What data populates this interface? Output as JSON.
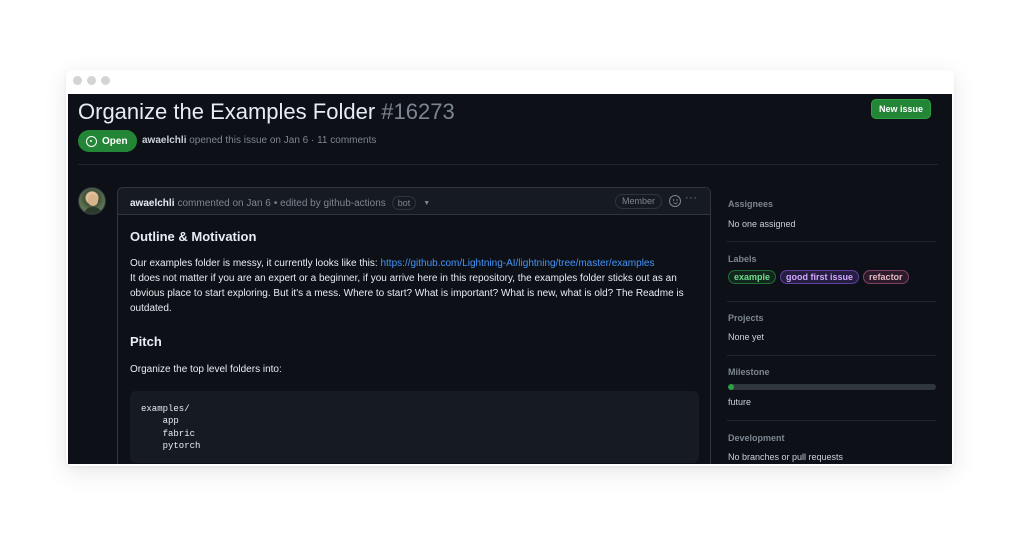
{
  "issue": {
    "title": "Organize the Examples Folder",
    "number": "#16273",
    "state": "Open",
    "author": "awaelchli",
    "meta": "opened this issue on Jan 6 · 11 comments"
  },
  "toolbar": {
    "new_issue_label": "New issue"
  },
  "comment": {
    "author": "awaelchli",
    "action": "commented on Jan 6",
    "edited": "• edited by github-actions",
    "bot_label": "bot",
    "member_label": "Member",
    "heading1": "Outline & Motivation",
    "para1_prefix": "Our examples folder is messy, it currently looks like this: ",
    "para1_link": "https://github.com/Lightning-AI/lightning/tree/master/examples",
    "para1_rest": "It does not matter if you are an expert or a beginner, if you arrive here in this repository, the examples folder sticks out as an obvious place to start exploring. But it's a mess. Where to start? What is important? What is new, what is old? The Readme is outdated.",
    "heading2": "Pitch",
    "para2": "Organize the top level folders into:",
    "code": "examples/\n    app\n    fabric\n    pytorch"
  },
  "sidebar": {
    "assignees_heading": "Assignees",
    "assignees_value": "No one assigned",
    "labels_heading": "Labels",
    "labels": [
      "example",
      "good first issue",
      "refactor"
    ],
    "projects_heading": "Projects",
    "projects_value": "None yet",
    "milestone_heading": "Milestone",
    "milestone_value": "future",
    "milestone_progress": 0.03,
    "development_heading": "Development",
    "development_value": "No branches or pull requests"
  },
  "colors": {
    "accent_green": "#238636",
    "link_blue": "#4493f8",
    "background": "#0d1117"
  }
}
